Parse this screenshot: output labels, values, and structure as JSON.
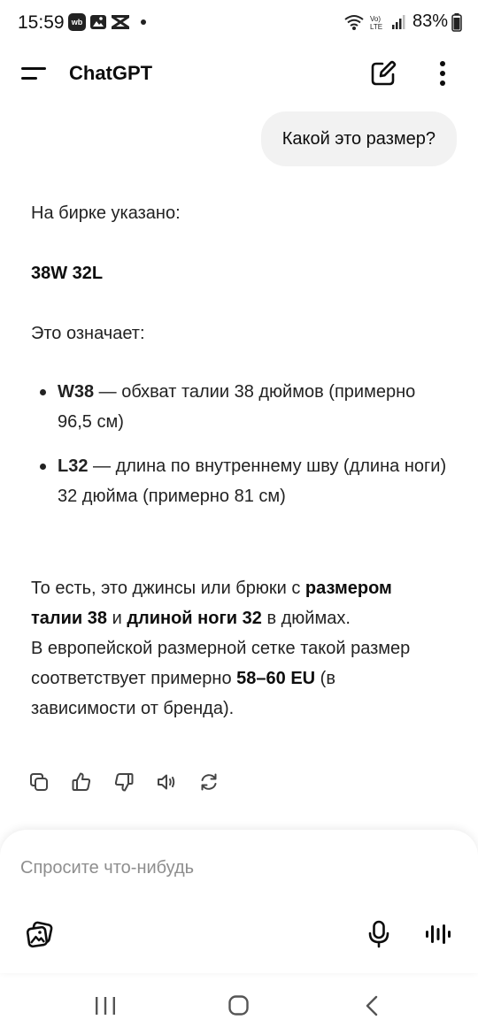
{
  "status_bar": {
    "time": "15:59",
    "left_icons": [
      "wb-badge-icon",
      "image-icon",
      "capcut-icon",
      "notification-dot"
    ],
    "wb_badge": "wb",
    "right_icons": [
      "wifi-icon",
      "volte-icon",
      "signal-icon",
      "battery-icon"
    ],
    "volte_label": "Vo) LTE",
    "battery": "83%"
  },
  "header": {
    "title": "ChatGPT"
  },
  "conversation": {
    "user_message": "Какой это размер?",
    "assistant": {
      "p1": "На бирке указано:",
      "p2": "38W 32L",
      "p3": "Это означает:",
      "bullets": [
        {
          "bold": "W38",
          "text": " — обхват талии 38 дюймов (примерно 96,5 см)"
        },
        {
          "bold": "L32",
          "text": " — длина по внутреннему шву (длина ноги) 32 дюйма (примерно 81 см)"
        }
      ],
      "p4": {
        "s1": "То есть, это джинсы или брюки с ",
        "b1": "размером талии 38",
        "s2": " и ",
        "b2": "длиной ноги 32",
        "s3": " в дюймах.",
        "s4": "В европейской размерной сетке такой размер соответствует примерно ",
        "b3": "58–60 EU",
        "s5": " (в зависимости от бренда)."
      }
    },
    "actions": [
      "copy-icon",
      "thumbs-up-icon",
      "thumbs-down-icon",
      "read-aloud-icon",
      "regenerate-icon"
    ]
  },
  "composer": {
    "placeholder": "Спросите что-нибудь",
    "value": ""
  },
  "colors": {
    "bubble": "#f2f2f2",
    "text": "#0d0d0d",
    "placeholder": "#8e8e8e"
  }
}
